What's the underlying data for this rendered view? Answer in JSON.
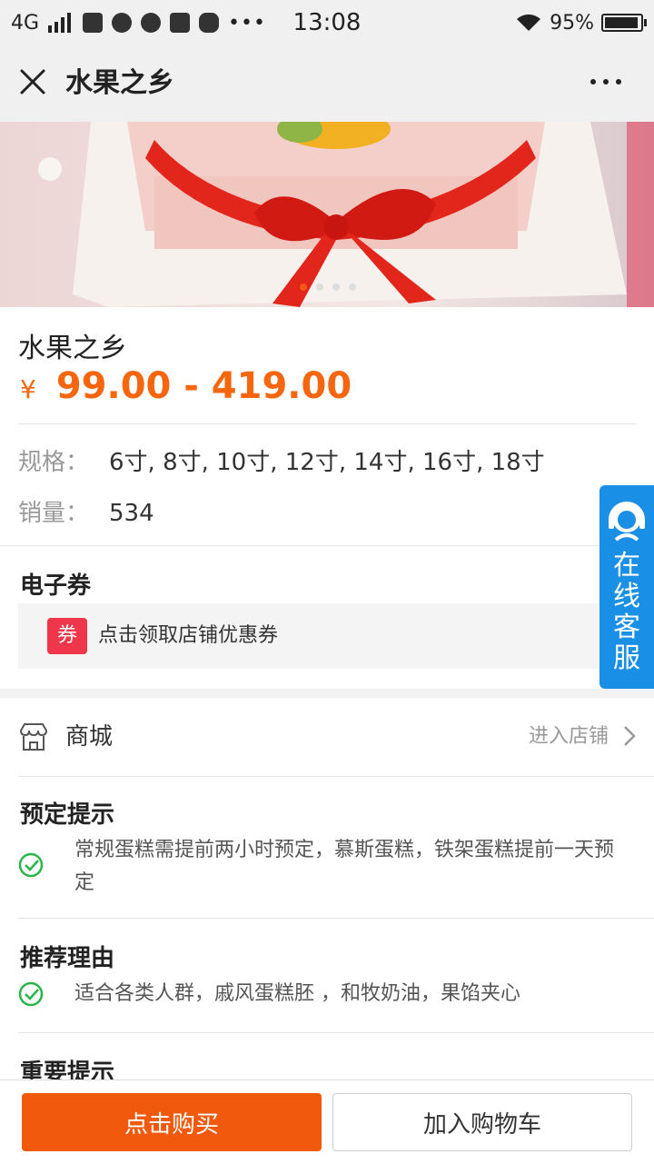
{
  "status_bar": {
    "network": "4G",
    "time": "13:08",
    "battery": "95%",
    "battery_level": 0.95
  },
  "nav": {
    "title": "水果之乡"
  },
  "banner": {
    "slide_count": 4,
    "active_index": 0
  },
  "product": {
    "title": "水果之乡",
    "currency": "¥",
    "price_range": "99.00 - 419.00",
    "spec_label": "规格：",
    "spec_value": "6寸, 8寸, 10寸, 12寸, 14寸, 16寸, 18寸",
    "sales_label": "销量：",
    "sales_value": "534"
  },
  "coupon": {
    "section_title": "电子券",
    "tag": "券",
    "text": "点击领取店铺优惠券"
  },
  "service": {
    "label": "在线客服"
  },
  "shop": {
    "name": "商城",
    "enter_label": "进入店铺"
  },
  "notices": [
    {
      "title": "预定提示",
      "text": "常规蛋糕需提前两小时预定，慕斯蛋糕，铁架蛋糕提前一天预定"
    },
    {
      "title": "推荐理由",
      "text": "适合各类人群，戚风蛋糕胚 ，和牧奶油，果馅夹心"
    },
    {
      "title": "重要提示"
    }
  ],
  "actions": {
    "buy_label": "点击购买",
    "cart_label": "加入购物车"
  },
  "colors": {
    "accent": "#f5660f",
    "buy_button": "#f15a0c",
    "coupon_tag": "#f0364a",
    "service_bg": "#1a8fe6",
    "check": "#2bb44a"
  }
}
